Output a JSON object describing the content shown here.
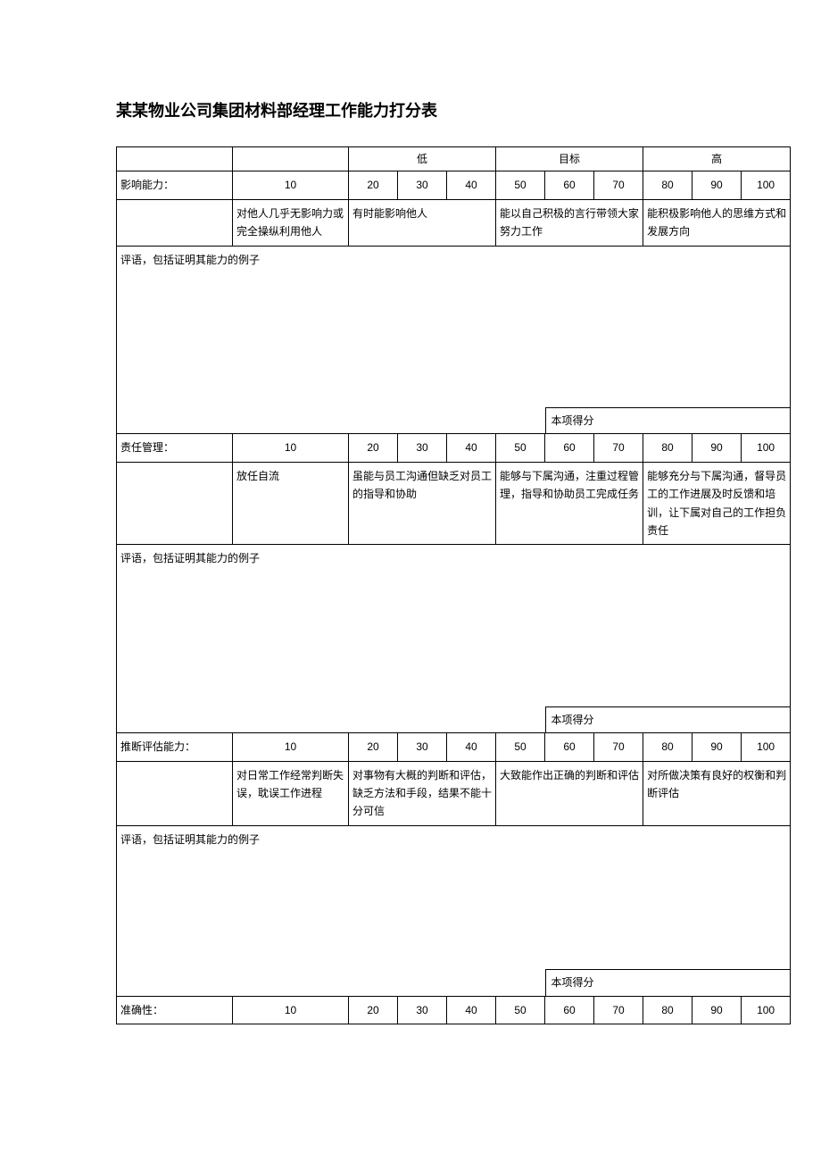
{
  "title": "某某物业公司集团材料部经理工作能力打分表",
  "level_headers": {
    "low": "低",
    "target": "目标",
    "high": "高"
  },
  "scores": [
    "10",
    "20",
    "30",
    "40",
    "50",
    "60",
    "70",
    "80",
    "90",
    "100"
  ],
  "comment_label": "评语，包括证明其能力的例子",
  "score_label": "本项得分",
  "sections": [
    {
      "name": "影响能力：",
      "d1": "对他人几乎无影响力或完全操纵利用他人",
      "d2": "有时能影响他人",
      "d3": "能以自己积极的言行带领大家努力工作",
      "d4": "能积极影响他人的思维方式和发展方向"
    },
    {
      "name": "责任管理：",
      "d1": "放任自流",
      "d2": "虽能与员工沟通但缺乏对员工的指导和协助",
      "d3": "能够与下属沟通，注重过程管理，指导和协助员工完成任务",
      "d4": "能够充分与下属沟通，督导员工的工作进展及时反馈和培训，让下属对自己的工作担负责任"
    },
    {
      "name": "推断评估能力：",
      "d1": "对日常工作经常判断失误，耽误工作进程",
      "d2": "对事物有大概的判断和评估，缺乏方法和手段，结果不能十分可信",
      "d3": "大致能作出正确的判断和评估",
      "d4": "对所做决策有良好的权衡和判断评估"
    },
    {
      "name": "准确性：",
      "d1": "",
      "d2": "",
      "d3": "",
      "d4": ""
    }
  ]
}
